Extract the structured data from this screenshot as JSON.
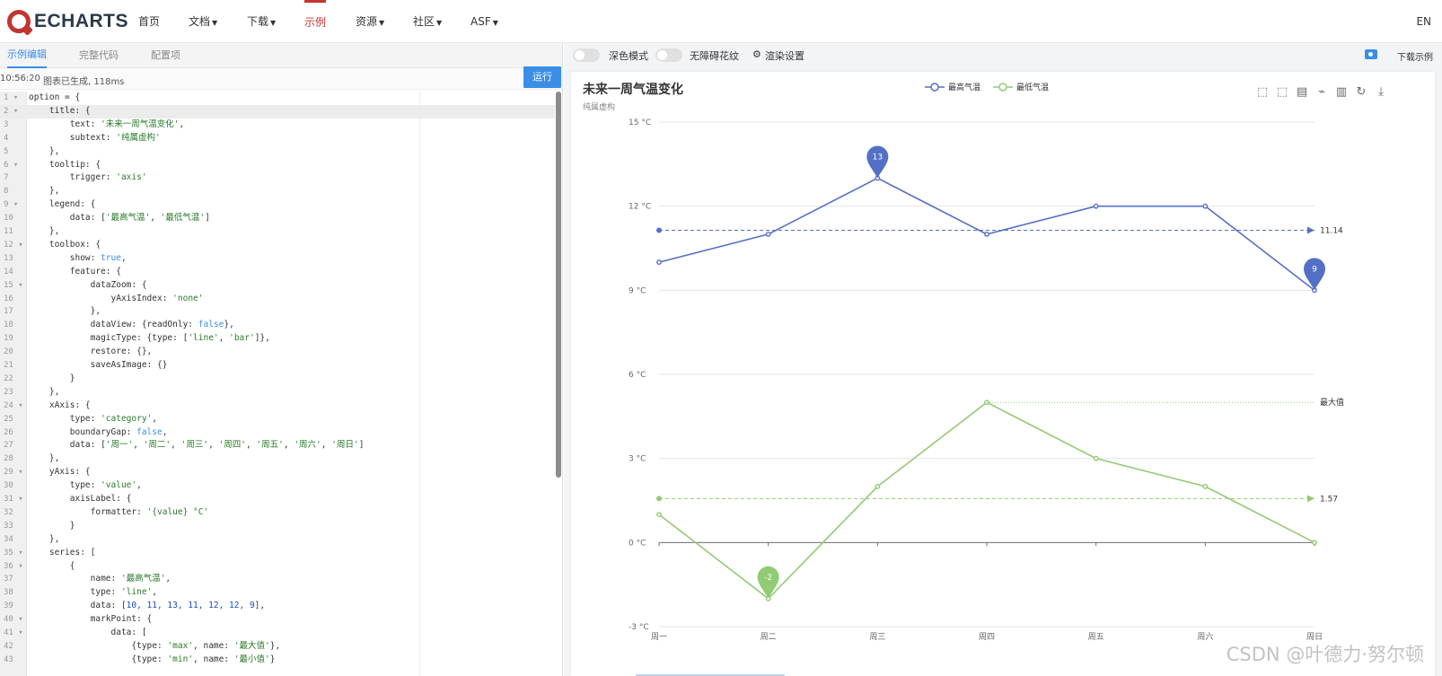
{
  "nav": {
    "logo_text": "ECHARTS",
    "items": [
      {
        "label": "首页",
        "caret": false
      },
      {
        "label": "文档",
        "caret": true
      },
      {
        "label": "下载",
        "caret": true
      },
      {
        "label": "示例",
        "caret": false
      },
      {
        "label": "资源",
        "caret": true
      },
      {
        "label": "社区",
        "caret": true
      },
      {
        "label": "ASF",
        "caret": true
      }
    ],
    "lang": "EN"
  },
  "editor": {
    "tabs": [
      "示例编辑",
      "完整代码",
      "配置项"
    ],
    "status_time": "10:56:20",
    "status_msg": "图表已生成, 118ms",
    "run_label": "运行",
    "lines": [
      "option = {",
      "    title: {",
      "        text: '未来一周气温变化',",
      "        subtext: '纯属虚构'",
      "    },",
      "    tooltip: {",
      "        trigger: 'axis'",
      "    },",
      "    legend: {",
      "        data: ['最高气温', '最低气温']",
      "    },",
      "    toolbox: {",
      "        show: true,",
      "        feature: {",
      "            dataZoom: {",
      "                yAxisIndex: 'none'",
      "            },",
      "            dataView: {readOnly: false},",
      "            magicType: {type: ['line', 'bar']},",
      "            restore: {},",
      "            saveAsImage: {}",
      "        }",
      "    },",
      "    xAxis: {",
      "        type: 'category',",
      "        boundaryGap: false,",
      "        data: ['周一', '周二', '周三', '周四', '周五', '周六', '周日']",
      "    },",
      "    yAxis: {",
      "        type: 'value',",
      "        axisLabel: {",
      "            formatter: '{value} °C'",
      "        }",
      "    },",
      "    series: [",
      "        {",
      "            name: '最高气温',",
      "            type: 'line',",
      "            data: [10, 11, 13, 11, 12, 12, 9],",
      "            markPoint: {",
      "                data: [",
      "                    {type: 'max', name: '最大值'},",
      "                    {type: 'min', name: '最小值'}"
    ],
    "fold_lines": [
      1,
      2,
      6,
      9,
      12,
      15,
      24,
      29,
      31,
      35,
      36,
      40,
      41
    ]
  },
  "preview": {
    "toggle_dark": "深色模式",
    "toggle_aria": "无障碍花纹",
    "render_settings": "渲染设置",
    "download": "下载示例"
  },
  "chart_data": {
    "type": "line",
    "title": "未来一周气温变化",
    "subtitle": "纯属虚构",
    "categories": [
      "周一",
      "周二",
      "周三",
      "周四",
      "周五",
      "周六",
      "周日"
    ],
    "y_ticks": [
      "15 °C",
      "12 °C",
      "9 °C",
      "6 °C",
      "3 °C",
      "0 °C",
      "-3 °C"
    ],
    "y_values": [
      15,
      12,
      9,
      6,
      3,
      0,
      -3
    ],
    "ylim": [
      -3,
      15
    ],
    "series": [
      {
        "name": "最高气温",
        "color": "#5470c6",
        "values": [
          10,
          11,
          13,
          11,
          12,
          12,
          9
        ],
        "mark_max": {
          "index": 2,
          "label": "13"
        },
        "mark_min": {
          "index": 6,
          "label": "9"
        },
        "mark_line": {
          "value": 11.14,
          "label": "11.14"
        }
      },
      {
        "name": "最低气温",
        "color": "#91cc75",
        "values": [
          1,
          -2,
          2,
          5,
          3,
          2,
          0
        ],
        "mark_min": {
          "index": 1,
          "label": "-2"
        },
        "mark_line_avg": {
          "value": 1.57,
          "label": "1.57"
        },
        "mark_line_max": {
          "value": 5,
          "label": "最大值"
        }
      }
    ],
    "toolbox": [
      "zoom-icon",
      "zoom-reset-icon",
      "data-view-icon",
      "line-icon",
      "bar-icon",
      "restore-icon",
      "save-icon"
    ],
    "watermark": "CSDN @叶德力·努尔顿"
  }
}
